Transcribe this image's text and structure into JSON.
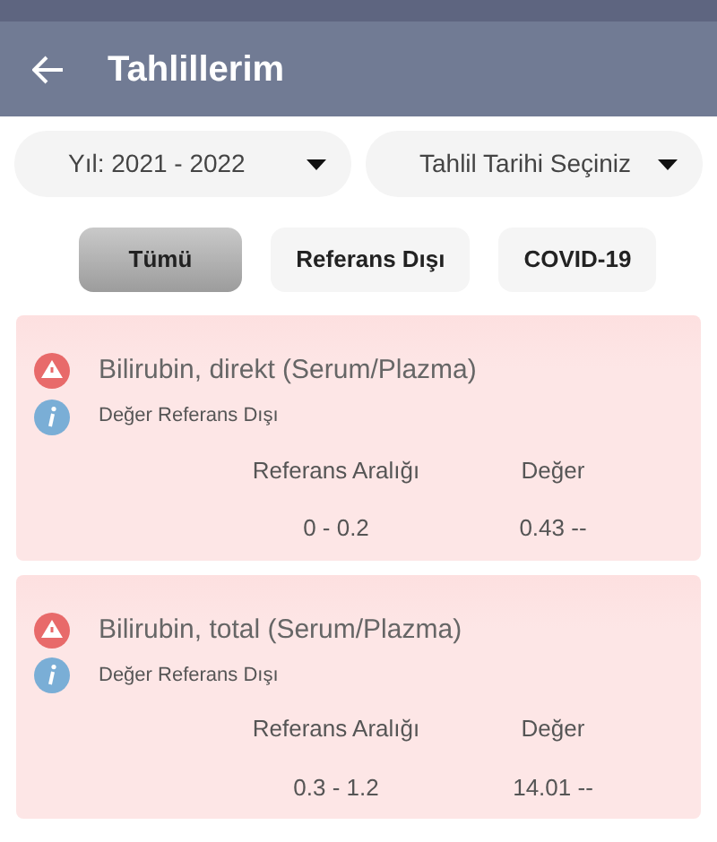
{
  "app_bar": {
    "title": "Tahlillerim"
  },
  "dropdowns": [
    {
      "label": "Yıl: 2021 - 2022"
    },
    {
      "label": "Tahlil Tarihi Seçiniz"
    }
  ],
  "filters": [
    {
      "label": "Tümü",
      "selected": true
    },
    {
      "label": "Referans Dışı",
      "selected": false
    },
    {
      "label": "COVID-19",
      "selected": false
    }
  ],
  "results": [
    {
      "test": "Bilirubin, direkt (Serum/Plazma)",
      "status": "Değer Referans Dışı",
      "range_header": "Referans Aralığı",
      "value_header": "Değer",
      "range": "0 - 0.2",
      "value": "0.43 --",
      "out_of_range": true
    },
    {
      "test": "Bilirubin, total (Serum/Plazma)",
      "status": "Değer Referans Dışı",
      "range_header": "Referans Aralığı",
      "value_header": "Değer",
      "range": "0.3 - 1.2",
      "value": "14.01 --",
      "out_of_range": true
    }
  ]
}
